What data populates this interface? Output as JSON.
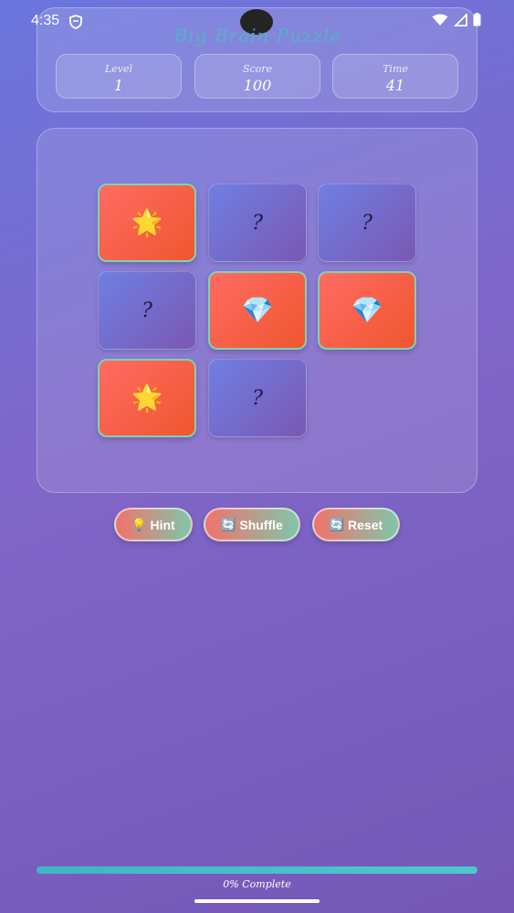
{
  "status_bar": {
    "time": "4:35"
  },
  "header": {
    "title": "Big Brain Puzzle",
    "stats": [
      {
        "label": "Level",
        "value": "1"
      },
      {
        "label": "Score",
        "value": "100"
      },
      {
        "label": "Time",
        "value": "41"
      }
    ]
  },
  "board": {
    "cards": [
      {
        "state": "revealed",
        "symbol": "🌟"
      },
      {
        "state": "hidden",
        "symbol": "?"
      },
      {
        "state": "hidden",
        "symbol": "?"
      },
      {
        "state": "hidden",
        "symbol": "?"
      },
      {
        "state": "revealed",
        "symbol": "💎"
      },
      {
        "state": "revealed",
        "symbol": "💎"
      },
      {
        "state": "revealed",
        "symbol": "🌟"
      },
      {
        "state": "hidden",
        "symbol": "?"
      }
    ]
  },
  "actions": {
    "hint": {
      "icon": "💡",
      "label": "Hint"
    },
    "shuffle": {
      "icon": "🔄",
      "label": "Shuffle"
    },
    "reset": {
      "icon": "🔄",
      "label": "Reset"
    }
  },
  "progress": {
    "percent": 0,
    "label": "0% Complete"
  },
  "colors": {
    "background_start": "#6b76dd",
    "background_end": "#7558b6",
    "card_revealed": "#ff6b63",
    "card_border": "#7fd3b0",
    "accent_teal": "#4fb9c6"
  }
}
